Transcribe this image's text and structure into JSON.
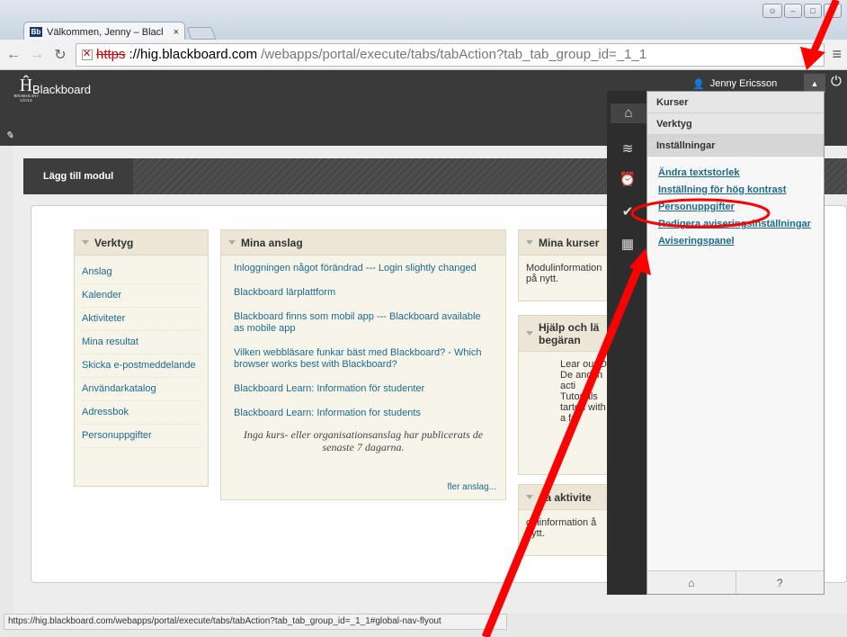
{
  "browser": {
    "tab_title": "Välkommen, Jenny – Blacl",
    "tab_close": "×",
    "favicon_label": "Bb",
    "url_scheme": "https",
    "url_host": "://hig.blackboard.com",
    "url_rest": "/webapps/portal/execute/tabs/tabAction?tab_tab_group_id=_1_1",
    "status_url": "https://hig.blackboard.com/webapps/portal/execute/tabs/tabAction?tab_tab_group_id=_1_1#global-nav-flyout",
    "icons": {
      "back": "back-arrow-icon",
      "forward": "forward-arrow-icon",
      "reload": "reload-icon",
      "menu": "hamburger-menu-icon"
    }
  },
  "header": {
    "logo_mark": "Ĥ",
    "logo_sub": "HÖGSKOLAN I GÄVLE",
    "brand": "Blackboard",
    "user_name": "Jenny Ericsson"
  },
  "toolbar": {
    "add_module": "Lägg till modul"
  },
  "tools": {
    "title": "Verktyg",
    "items": [
      "Anslag",
      "Kalender",
      "Aktiviteter",
      "Mina resultat",
      "Skicka e-postmeddelande",
      "Användarkatalog",
      "Adressbok",
      "Personuppgifter"
    ]
  },
  "announcements": {
    "title": "Mina anslag",
    "items": [
      "Inloggningen något förändrad --- Login slightly changed",
      "Blackboard lärplattform",
      "Blackboard finns som mobil app --- Blackboard available as mobile app",
      "Vilken webbläsare funkar bäst med Blackboard? - Which browser works best with Blackboard?",
      "Blackboard Learn: Information för studenter",
      "Blackboard Learn: Information for students"
    ],
    "note": "Inga kurs- eller organisationsanslag har publicerats de senaste 7 dagarna.",
    "more": "fler anslag..."
  },
  "my_courses": {
    "title": "Mina kurser",
    "text": "Modulinformation på nytt."
  },
  "help": {
    "title": "Hjälp och lä begäran",
    "text": "Lear our D De and in acti Tutorials tarted with a fe"
  },
  "activities": {
    "title": "na aktivite",
    "text": "dulinformation å nytt."
  },
  "flyout": {
    "tabs": [
      "Kurser",
      "Verktyg",
      "Inställningar"
    ],
    "links": [
      "Ändra textstorlek",
      "Inställning för hög kontrast",
      "Personuppgifter",
      "Redigera aviseringsinställningar",
      "Aviseringspanel"
    ],
    "footer_home": "⌂",
    "footer_help": "?"
  },
  "annotation_color": "#ff0000"
}
